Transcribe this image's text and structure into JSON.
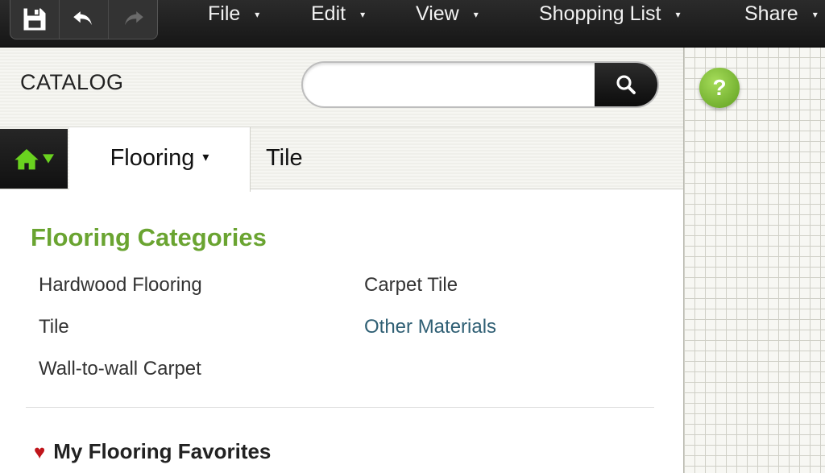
{
  "menubar": {
    "tools": [
      {
        "name": "save",
        "icon": "floppy-disk-icon"
      },
      {
        "name": "undo",
        "icon": "undo-icon"
      },
      {
        "name": "redo",
        "icon": "redo-icon",
        "disabled": true
      }
    ],
    "menus": [
      {
        "label": "File",
        "caret": "▾"
      },
      {
        "label": "Edit",
        "caret": "▾"
      },
      {
        "label": "View",
        "caret": "▾"
      },
      {
        "label": "Shopping List",
        "caret": "▾"
      },
      {
        "label": "Share",
        "caret": "▾"
      }
    ]
  },
  "catalog": {
    "title": "CATALOG",
    "search": {
      "value": "",
      "placeholder": "",
      "button_icon": "search-icon"
    },
    "tabs": {
      "home_icon": "home-icon",
      "home_color": "#6ad21f",
      "active": {
        "label": "Flooring",
        "caret": "▾"
      },
      "next": {
        "label": "Tile"
      }
    },
    "section_title": "Flooring Categories",
    "categories_left": [
      "Hardwood Flooring",
      "Tile",
      "Wall-to-wall Carpet"
    ],
    "categories_right": [
      "Carpet Tile",
      "Other Materials"
    ],
    "favorites": {
      "heart": "♥",
      "label": "My Flooring Favorites"
    }
  },
  "help": {
    "label": "?"
  },
  "colors": {
    "accent_green": "#6aa431",
    "link_blue": "#2f5f74",
    "heart_red": "#c0151b"
  }
}
